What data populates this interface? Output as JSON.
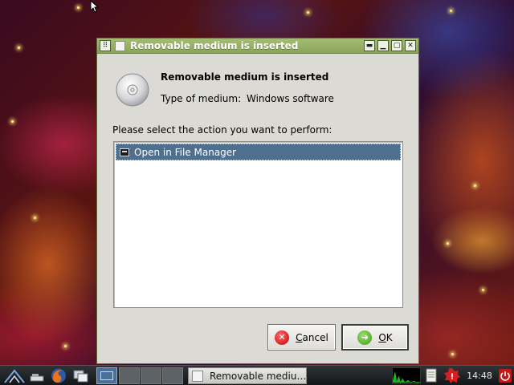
{
  "dialog": {
    "title": "Removable medium is inserted",
    "heading": "Removable medium is inserted",
    "medium_type_label": "Type of medium:",
    "medium_type_value": "Windows software",
    "prompt": "Please select the action you want to perform:",
    "actions": [
      {
        "label": "Open in File Manager",
        "selected": true
      }
    ],
    "buttons": {
      "cancel_first": "C",
      "cancel_rest": "ancel",
      "ok_first": "O",
      "ok_rest": "K"
    }
  },
  "taskbar": {
    "active_task_label": "Removable mediu…",
    "clock": "14:48"
  },
  "colors": {
    "titlebar": "#9ab567",
    "selection": "#4f6f8f",
    "dialog_bg": "#dcdad5"
  },
  "icons": [
    "menu-icon",
    "window-icon",
    "minimize-icon",
    "restore-icon",
    "maximize-icon",
    "close-icon",
    "cd-icon",
    "cancel-icon",
    "ok-icon",
    "start-menu-icon",
    "show-desktop-icon",
    "firefox-icon",
    "window-switch-icon",
    "power-icon"
  ]
}
